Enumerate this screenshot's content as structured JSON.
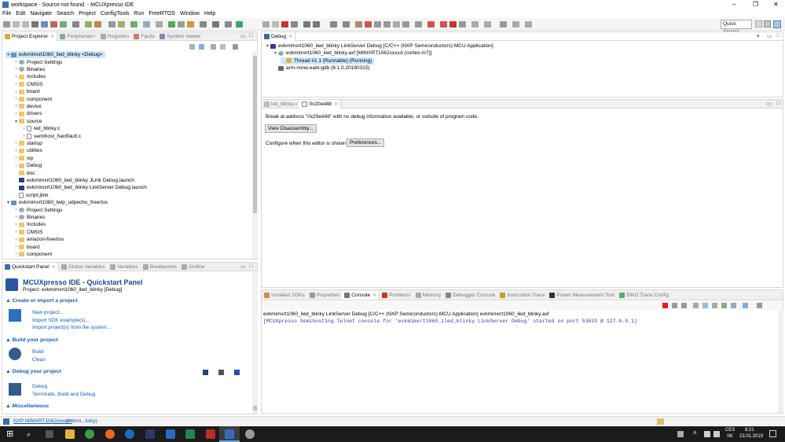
{
  "window": {
    "title": "workspace - Source not found. - MCUXpresso IDE",
    "minimize": "–",
    "maximize": "❐",
    "close": "✕"
  },
  "menu": [
    "File",
    "Edit",
    "Navigate",
    "Search",
    "Project",
    "ConfigTools",
    "Run",
    "FreeRTOS",
    "Window",
    "Help"
  ],
  "quick_access": "Quick Access",
  "project_explorer": {
    "tabs": [
      "Project Explorer",
      "Peripherals+",
      "Registers",
      "Faults",
      "Symbol Viewer"
    ],
    "rows": [
      {
        "label": "evkmimxrt1060_iled_blinky <Debug>",
        "indent": 0,
        "arrow": "▾",
        "icon": "proj",
        "sel": true
      },
      {
        "label": "Project Settings",
        "indent": 1,
        "arrow": "›",
        "icon": "gear"
      },
      {
        "label": "Binaries",
        "indent": 1,
        "arrow": "›",
        "icon": "gear"
      },
      {
        "label": "Includes",
        "indent": 1,
        "arrow": "›",
        "icon": "folder"
      },
      {
        "label": "CMSIS",
        "indent": 1,
        "arrow": "›",
        "icon": "folder"
      },
      {
        "label": "board",
        "indent": 1,
        "arrow": "›",
        "icon": "folder"
      },
      {
        "label": "component",
        "indent": 1,
        "arrow": "›",
        "icon": "folder"
      },
      {
        "label": "device",
        "indent": 1,
        "arrow": "›",
        "icon": "folder"
      },
      {
        "label": "drivers",
        "indent": 1,
        "arrow": "›",
        "icon": "folder"
      },
      {
        "label": "source",
        "indent": 1,
        "arrow": "▾",
        "icon": "folder"
      },
      {
        "label": "led_blinky.c",
        "indent": 2,
        "arrow": "›",
        "icon": "file"
      },
      {
        "label": "semihost_hardfault.c",
        "indent": 2,
        "arrow": "›",
        "icon": "file"
      },
      {
        "label": "startup",
        "indent": 1,
        "arrow": "›",
        "icon": "folder"
      },
      {
        "label": "utilities",
        "indent": 1,
        "arrow": "›",
        "icon": "folder"
      },
      {
        "label": "xip",
        "indent": 1,
        "arrow": "›",
        "icon": "folder"
      },
      {
        "label": "Debug",
        "indent": 1,
        "arrow": "›",
        "icon": "folder"
      },
      {
        "label": "doc",
        "indent": 1,
        "arrow": "",
        "icon": "folder"
      },
      {
        "label": "evkmimxrt1060_iled_blinky JLink Debug.launch",
        "indent": 1,
        "arrow": "",
        "icon": "launch"
      },
      {
        "label": "evkmimxrt1060_iled_blinky LinkServer Debug.launch",
        "indent": 1,
        "arrow": "",
        "icon": "launch"
      },
      {
        "label": "script.jlink",
        "indent": 1,
        "arrow": "",
        "icon": "file"
      },
      {
        "label": "evkmimxrt1060_lwip_udpecho_freertos",
        "indent": 0,
        "arrow": "▾",
        "icon": "proj"
      },
      {
        "label": "Project Settings",
        "indent": 1,
        "arrow": "›",
        "icon": "gear"
      },
      {
        "label": "Binaries",
        "indent": 1,
        "arrow": "›",
        "icon": "gear"
      },
      {
        "label": "Includes",
        "indent": 1,
        "arrow": "›",
        "icon": "folder"
      },
      {
        "label": "CMSIS",
        "indent": 1,
        "arrow": "›",
        "icon": "folder"
      },
      {
        "label": "amazon-freertos",
        "indent": 1,
        "arrow": "›",
        "icon": "folder"
      },
      {
        "label": "board",
        "indent": 1,
        "arrow": "›",
        "icon": "folder"
      },
      {
        "label": "component",
        "indent": 1,
        "arrow": "›",
        "icon": "folder"
      }
    ]
  },
  "quickstart": {
    "tabs": [
      "Quickstart Panel",
      "Global Variables",
      "Variables",
      "Breakpoints",
      "Outline"
    ],
    "title": "MCUXpresso IDE - Quickstart Panel",
    "project": "Project: evkmimxrt1060_iled_blinky [Debug]",
    "sections": {
      "create": "Create or import a project",
      "build": "Build your project",
      "debug": "Debug your project",
      "misc": "Miscellaneous"
    },
    "links": {
      "new_project": "New project...",
      "import_sdk": "Import SDK example(s)...",
      "import_fs": "Import project(s) from file system...",
      "build": "Build",
      "clean": "Clean",
      "debug": "Debug",
      "terminate": "Terminate, Build and Debug"
    }
  },
  "debug_view": {
    "tab": "Debug",
    "rows": [
      "evkmimxrt1060_iled_blinky LinkServer Debug [C/C++ (NXP Semiconductors) MCU Application]",
      "evkmimxrt1060_iled_blinky.axf [MIMXRT1062xxxxA (cortex-m7)]",
      "Thread #1 1 (Runnable) (Running)",
      "arm-none-eabi-gdb (8.1.0.20180315)"
    ]
  },
  "editor": {
    "tabs": [
      "led_blinky.c",
      "0x20ed48"
    ],
    "message": "Break at address \"0x20ed48\" with no debug information available, or outside of program code.",
    "view_disassembly": "View Disassembly...",
    "configure_label": "Configure when this editor is shown",
    "preferences": "Preferences..."
  },
  "console": {
    "tabs": [
      "Installed SDKs",
      "Properties",
      "Console",
      "Problems",
      "Memory",
      "Debugger Console",
      "Instruction Trace",
      "Power Measurement Tool",
      "SWO Trace Config"
    ],
    "header": "evkmimxrt1060_iled_blinky LinkServer Debug [C/C++ (NXP Semiconductors) MCU Application] evkmimxrt1060_iled_blinky.axf",
    "line": "[MCUXpresso Semihosting Telnet console for 'evkmimxrt1060_iled_blinky LinkServer Debug' started on port 53833 @ 127.0.0.1]"
  },
  "status": {
    "link_text": "NXP MIMXRT1062xxxxA*",
    "link_suffix": "(evkmi...linky)"
  },
  "taskbar": {
    "lang": "CES",
    "lang2": "SK",
    "time": "8:21",
    "date": "23.01.2019"
  }
}
